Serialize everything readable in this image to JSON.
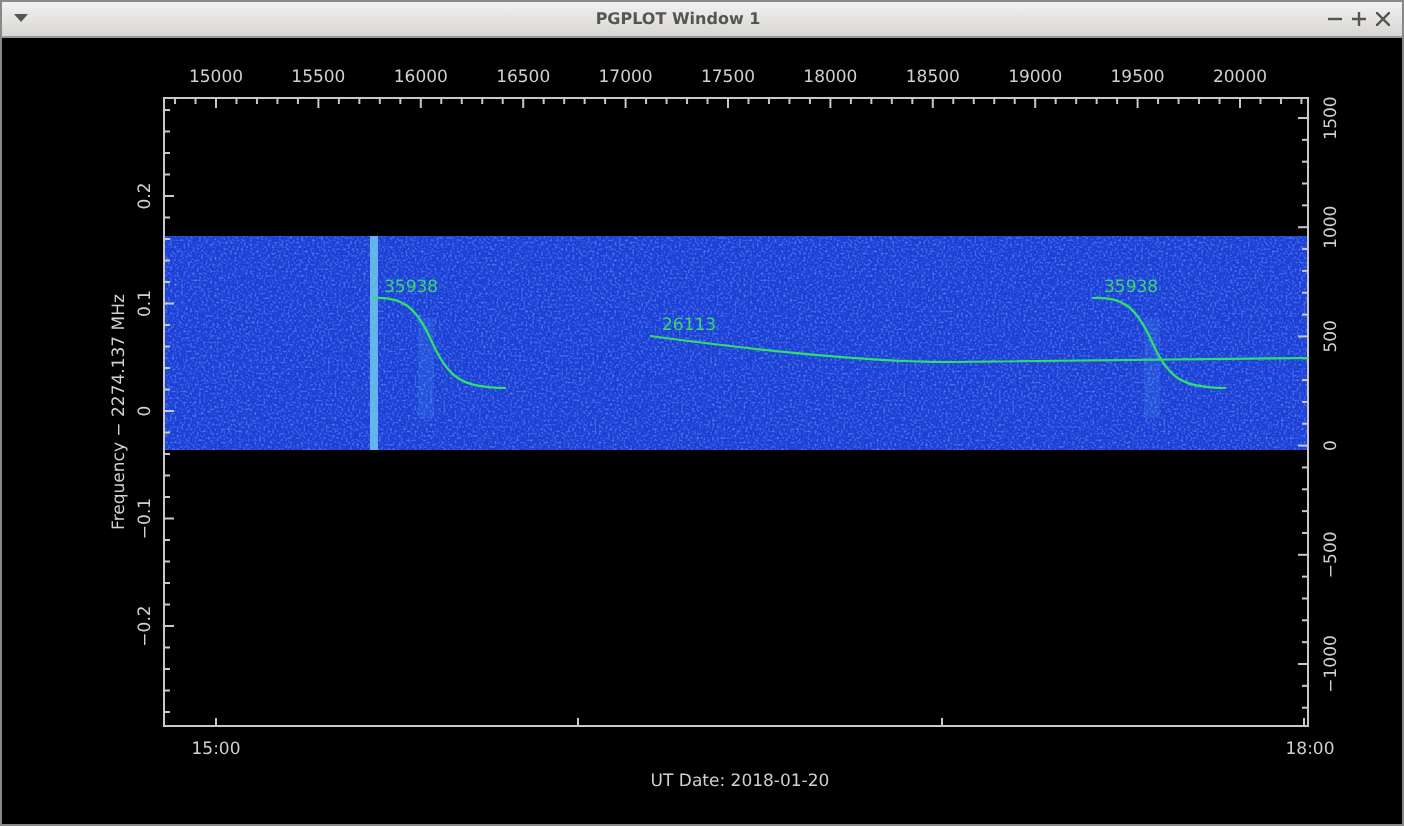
{
  "window": {
    "title": "PGPLOT Window 1"
  },
  "plot": {
    "top_axis": {
      "ticks": [
        "15000",
        "15500",
        "16000",
        "16500",
        "17000",
        "17500",
        "18000",
        "18500",
        "19000",
        "19500",
        "20000"
      ]
    },
    "left_axis": {
      "label": "Frequency − 2274.137 MHz",
      "ticks": [
        "0.2",
        "0.1",
        "0",
        "−0.1",
        "−0.2"
      ]
    },
    "right_axis": {
      "ticks": [
        "1500",
        "1000",
        "500",
        "0",
        "−500",
        "−1000"
      ]
    },
    "bottom_axis": {
      "label": "UT Date: 2018-01-20",
      "ticks": [
        "15:00",
        "18:00"
      ]
    },
    "tracks": [
      {
        "label": "35938",
        "kind": "falling"
      },
      {
        "label": "26113",
        "kind": "flat"
      },
      {
        "label": "35938",
        "kind": "falling"
      }
    ]
  }
}
